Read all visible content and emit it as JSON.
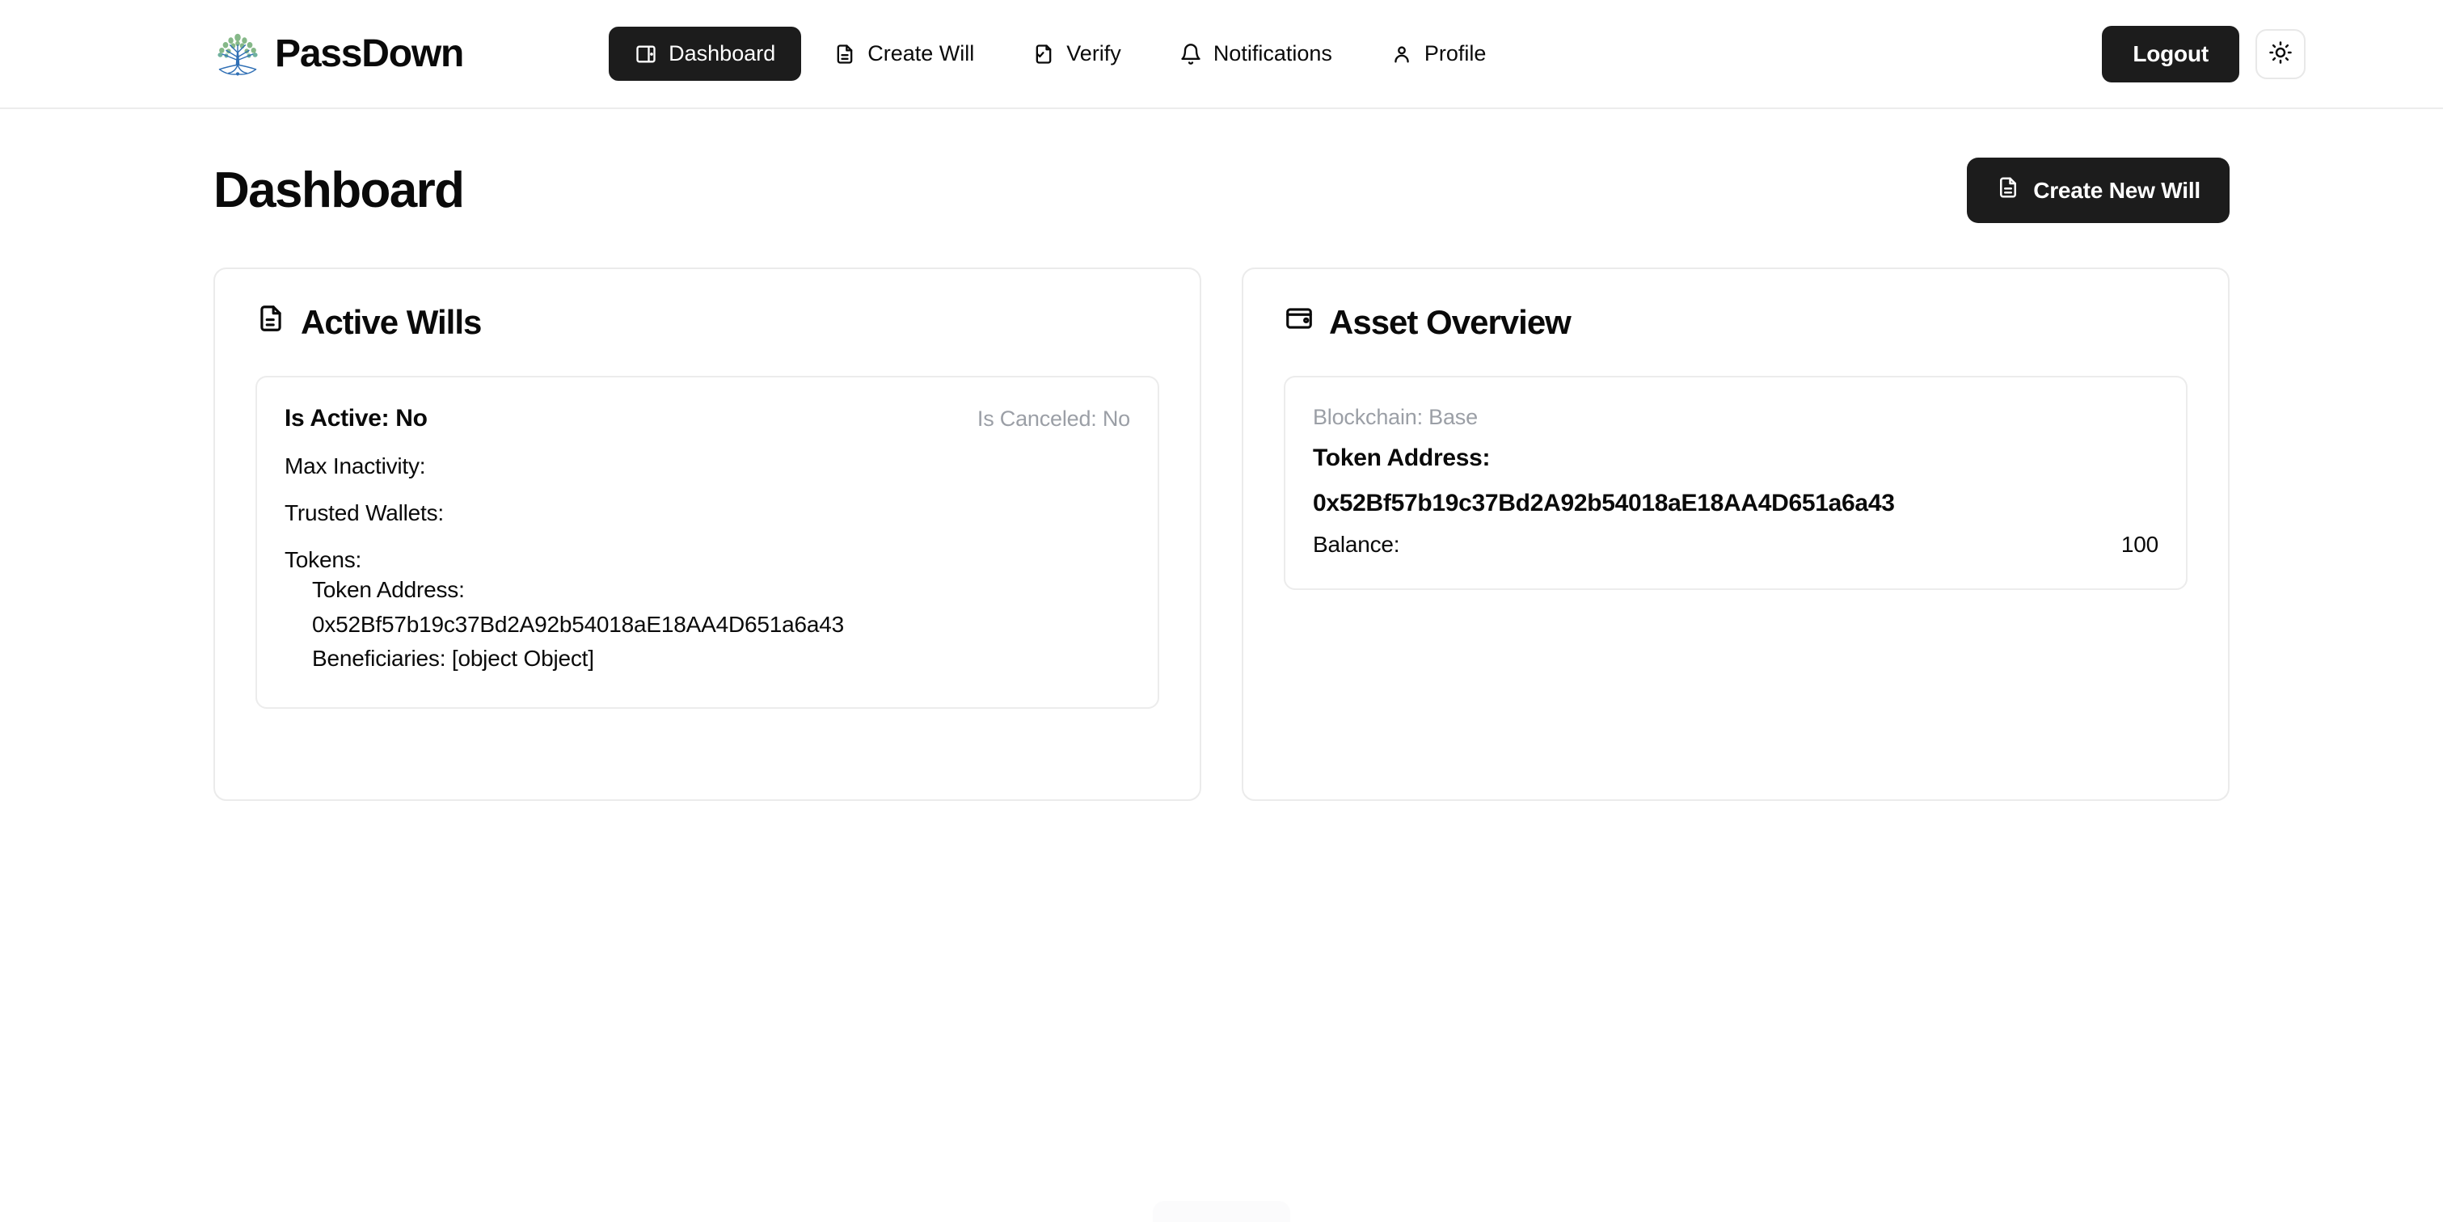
{
  "brand": {
    "name": "PassDown",
    "logo_icon": "tree-of-life-logo"
  },
  "nav": {
    "items": [
      {
        "label": "Dashboard",
        "icon": "layout-dashboard-icon",
        "active": true
      },
      {
        "label": "Create Will",
        "icon": "file-text-icon",
        "active": false
      },
      {
        "label": "Verify",
        "icon": "file-check-icon",
        "active": false
      },
      {
        "label": "Notifications",
        "icon": "bell-icon",
        "active": false
      },
      {
        "label": "Profile",
        "icon": "user-icon",
        "active": false
      }
    ],
    "logout_label": "Logout",
    "theme_toggle_icon": "sun-icon"
  },
  "page": {
    "title": "Dashboard",
    "create_will_button": {
      "label": "Create New Will",
      "icon": "file-text-icon"
    }
  },
  "active_wills": {
    "title": "Active Wills",
    "icon": "file-text-icon",
    "will": {
      "is_active": "Is Active: No",
      "is_canceled": "Is Canceled: No",
      "max_inactivity": "Max Inactivity:",
      "trusted_wallets": "Trusted Wallets:",
      "tokens_label": "Tokens:",
      "token_address_label": "Token Address:",
      "token_address_value": "0x52Bf57b19c37Bd2A92b54018aE18AA4D651a6a43",
      "beneficiaries": "Beneficiaries: [object Object]"
    }
  },
  "asset_overview": {
    "title": "Asset Overview",
    "icon": "wallet-icon",
    "asset": {
      "blockchain": "Blockchain: Base",
      "token_address_label": "Token Address:",
      "token_address_value": "0x52Bf57b19c37Bd2A92b54018aE18AA4D651a6a43",
      "balance_label": "Balance:",
      "balance_value": "100"
    }
  },
  "widgets": {
    "droplet_icon": "water-droplet-sparkle-icon"
  },
  "colors": {
    "accent_dark": "#1c1c1c",
    "muted_text": "#9b9fa6",
    "border": "#ececec",
    "droplet_blue": "#2e9fe8",
    "logo_green": "#6fae72",
    "logo_blue": "#2f6fb5"
  }
}
